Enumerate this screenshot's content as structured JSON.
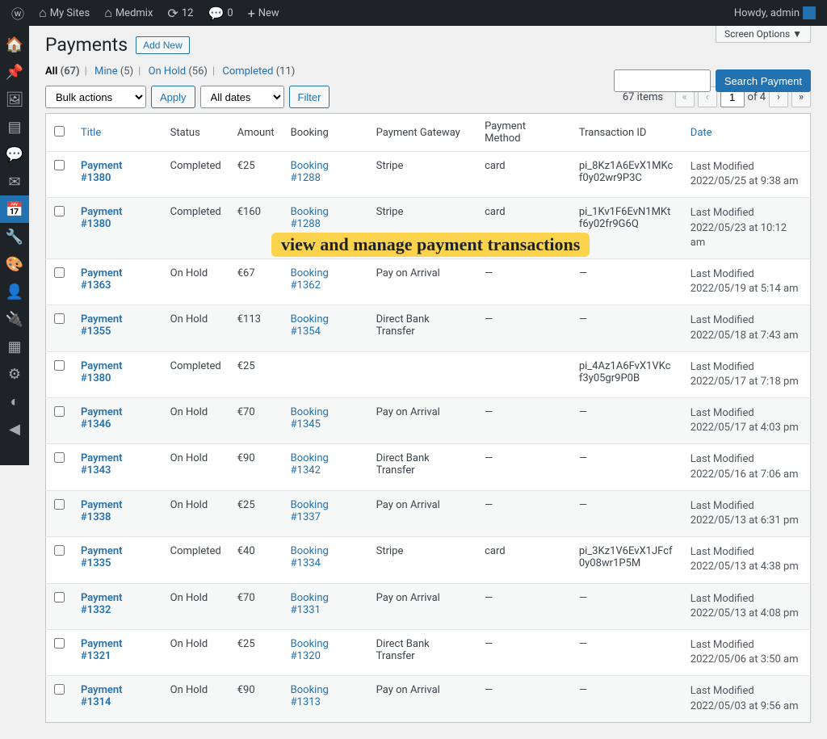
{
  "toolbar": {
    "my_sites": "My Sites",
    "site_name": "Medmix",
    "updates": "12",
    "comments": "0",
    "new": "New",
    "howdy": "Howdy, admin"
  },
  "screen_options": "Screen Options ▼",
  "page_title": "Payments",
  "add_new": "Add New",
  "views": {
    "all": {
      "label": "All",
      "count": "(67)"
    },
    "mine": {
      "label": "Mine",
      "count": "(5)"
    },
    "onhold": {
      "label": "On Hold",
      "count": "(56)"
    },
    "completed": {
      "label": "Completed",
      "count": "(11)"
    }
  },
  "bulk_actions": "Bulk actions",
  "apply": "Apply",
  "all_dates": "All dates",
  "filter": "Filter",
  "search_btn": "Search Payment",
  "paging": {
    "items": "67 items",
    "page": "1",
    "of": "of 4"
  },
  "cols": {
    "title": "Title",
    "status": "Status",
    "amount": "Amount",
    "booking": "Booking",
    "gateway": "Payment Gateway",
    "method": "Payment Method",
    "txn": "Transaction ID",
    "date": "Date"
  },
  "date_label": "Last Modified",
  "annotation": "view and manage payment transactions",
  "rows": [
    {
      "title": "Payment #1380",
      "status": "Completed",
      "amount": "€25",
      "booking": "Booking #1288",
      "gateway": "Stripe",
      "method": "card",
      "txn": "pi_8Kz1A6EvX1MKcf0y02wr9P3C",
      "date": "2022/05/25 at 9:38 am"
    },
    {
      "title": "Payment #1380",
      "status": "Completed",
      "amount": "€160",
      "booking": "Booking #1288",
      "gateway": "Stripe",
      "method": "card",
      "txn": "pi_1Kv1F6EvN1MKtf6y02fr9G6Q",
      "date": "2022/05/23 at 10:12 am"
    },
    {
      "title": "Payment #1363",
      "status": "On Hold",
      "amount": "€67",
      "booking": "Booking #1362",
      "gateway": "Pay on Arrival",
      "method": "—",
      "txn": "—",
      "date": "2022/05/19 at 5:14 am"
    },
    {
      "title": "Payment #1355",
      "status": "On Hold",
      "amount": "€113",
      "booking": "Booking #1354",
      "gateway": "Direct Bank Transfer",
      "method": "—",
      "txn": "—",
      "date": "2022/05/18 at 7:43 am"
    },
    {
      "title": "Payment #1380",
      "status": "Completed",
      "amount": "€25",
      "booking": "",
      "gateway": "",
      "method": "",
      "txn": "pi_4Az1A6FvX1VKcf3y05gr9P0B",
      "date": "2022/05/17 at 7:18 pm"
    },
    {
      "title": "Payment #1346",
      "status": "On Hold",
      "amount": "€70",
      "booking": "Booking #1345",
      "gateway": "Pay on Arrival",
      "method": "—",
      "txn": "—",
      "date": "2022/05/17 at 4:03 pm"
    },
    {
      "title": "Payment #1343",
      "status": "On Hold",
      "amount": "€90",
      "booking": "Booking #1342",
      "gateway": "Direct Bank Transfer",
      "method": "—",
      "txn": "—",
      "date": "2022/05/16 at 7:06 am"
    },
    {
      "title": "Payment #1338",
      "status": "On Hold",
      "amount": "€25",
      "booking": "Booking #1337",
      "gateway": "Pay on Arrival",
      "method": "—",
      "txn": "—",
      "date": "2022/05/13 at 6:31 pm"
    },
    {
      "title": "Payment #1335",
      "status": "Completed",
      "amount": "€40",
      "booking": "Booking #1334",
      "gateway": "Stripe",
      "method": "card",
      "txn": "pi_3Kz1V6EvX1JFcf0y08wr1P5M",
      "date": "2022/05/13 at 4:38 pm"
    },
    {
      "title": "Payment #1332",
      "status": "On Hold",
      "amount": "€70",
      "booking": "Booking #1331",
      "gateway": "Pay on Arrival",
      "method": "—",
      "txn": "—",
      "date": "2022/05/13 at 4:08 pm"
    },
    {
      "title": "Payment #1321",
      "status": "On Hold",
      "amount": "€25",
      "booking": "Booking #1320",
      "gateway": "Direct Bank Transfer",
      "method": "—",
      "txn": "—",
      "date": "2022/05/06 at 3:50 am"
    },
    {
      "title": "Payment #1314",
      "status": "On Hold",
      "amount": "€90",
      "booking": "Booking #1313",
      "gateway": "Pay on Arrival",
      "method": "—",
      "txn": "—",
      "date": "2022/05/03 at 9:56 am"
    }
  ]
}
